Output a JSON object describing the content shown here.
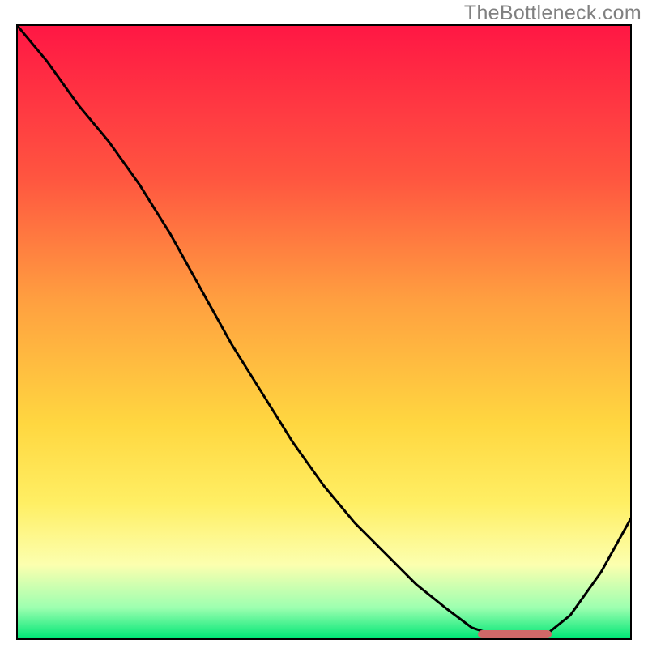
{
  "watermark": "TheBottleneck.com",
  "chart_data": {
    "type": "line",
    "title": "",
    "xlabel": "",
    "ylabel": "",
    "x": [
      0.0,
      0.05,
      0.1,
      0.15,
      0.2,
      0.25,
      0.3,
      0.35,
      0.4,
      0.45,
      0.5,
      0.55,
      0.6,
      0.65,
      0.7,
      0.74,
      0.8,
      0.85,
      0.9,
      0.95,
      1.0
    ],
    "y": [
      1.0,
      0.94,
      0.87,
      0.81,
      0.74,
      0.66,
      0.57,
      0.48,
      0.4,
      0.32,
      0.25,
      0.19,
      0.14,
      0.09,
      0.05,
      0.02,
      0.0,
      0.0,
      0.04,
      0.11,
      0.2
    ],
    "xlim": [
      0,
      1
    ],
    "ylim": [
      0,
      1
    ],
    "gradient_colors": {
      "top": "#ff1744",
      "upper_mid": "#ffa040",
      "lower_mid": "#ffef64",
      "bottom": "#00e676"
    },
    "marker": {
      "x_start": 0.75,
      "x_end": 0.87,
      "y": 0.0,
      "color": "#d06868"
    }
  }
}
